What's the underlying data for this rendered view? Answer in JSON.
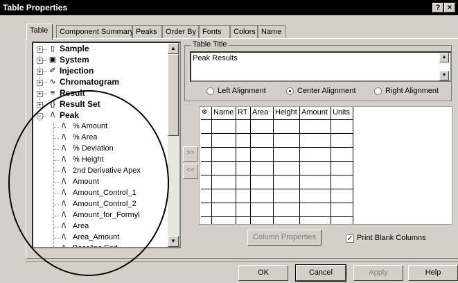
{
  "window": {
    "title": "Table Properties"
  },
  "titlebar_buttons": {
    "help": "?",
    "close": "×"
  },
  "tabs": [
    {
      "label": "Table"
    },
    {
      "label": "Component Summary"
    },
    {
      "label": "Peaks"
    },
    {
      "label": "Order By"
    },
    {
      "label": "Fonts"
    },
    {
      "label": "Colors"
    },
    {
      "label": "Name"
    }
  ],
  "tree": {
    "nodes": [
      {
        "label": "Sample",
        "icon": "sample-icon",
        "glyph": "▯"
      },
      {
        "label": "System",
        "icon": "system-icon",
        "glyph": "▣"
      },
      {
        "label": "Injection",
        "icon": "syringe-icon",
        "glyph": "✐"
      },
      {
        "label": "Chromatogram",
        "icon": "chromatogram-icon",
        "glyph": "∿"
      },
      {
        "label": "Result",
        "icon": "result-icon",
        "glyph": "≡"
      },
      {
        "label": "Result Set",
        "icon": "result-set-icon",
        "glyph": "{}"
      },
      {
        "label": "Peak",
        "icon": "peak-icon",
        "glyph": "/\\"
      }
    ],
    "children": [
      {
        "label": "% Amount"
      },
      {
        "label": "% Area"
      },
      {
        "label": "% Deviation"
      },
      {
        "label": "% Height"
      },
      {
        "label": "2nd Derivative Apex"
      },
      {
        "label": "Amount"
      },
      {
        "label": "Amount_Control_1"
      },
      {
        "label": "Amount_Control_2"
      },
      {
        "label": "Amount_for_Formyl"
      },
      {
        "label": "Area"
      },
      {
        "label": "Area_Amount"
      },
      {
        "label": "Baseline End"
      }
    ]
  },
  "table_title": {
    "group_label": "Table Title",
    "value": "Peak Results"
  },
  "alignment": [
    {
      "label": "Left Alignment",
      "selected": false
    },
    {
      "label": "Center Alignment",
      "selected": true
    },
    {
      "label": "Right Alignment",
      "selected": false
    }
  ],
  "grid": {
    "headers": [
      "Name",
      "RT",
      "Area",
      "Height",
      "Amount",
      "Units"
    ]
  },
  "arrows": {
    "add": ">>",
    "remove": "<<"
  },
  "column_properties": "Column Properties",
  "print_blank": {
    "label": "Print Blank Columns",
    "checked": true
  },
  "buttons": {
    "ok": "OK",
    "cancel": "Cancel",
    "apply": "Apply",
    "help": "Help"
  }
}
